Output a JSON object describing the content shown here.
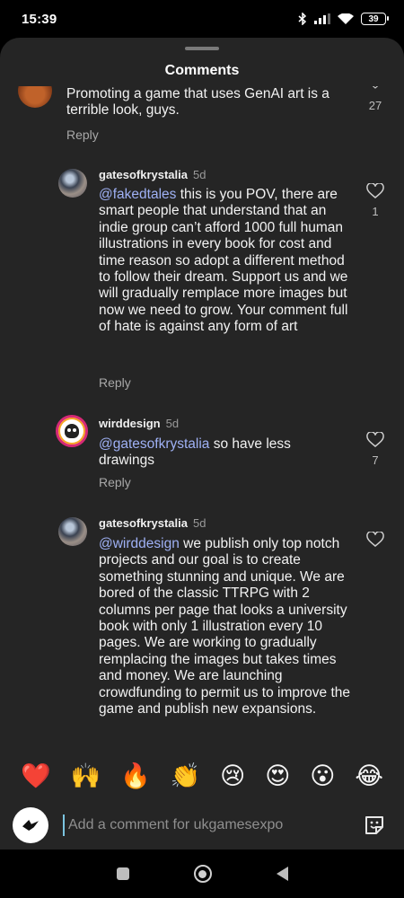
{
  "status": {
    "time": "15:39",
    "battery": "39"
  },
  "sheet": {
    "title": "Comments"
  },
  "comments": [
    {
      "text": "Promoting a game that uses GenAI art is a terrible look, guys.",
      "reply_label": "Reply",
      "likes": "27"
    },
    {
      "username": "gatesofkrystalia",
      "age": "5d",
      "mention": "@fakedtales",
      "text": " this is you POV, there are smart people that understand that an indie group can’t afford 1000 full human illustrations in every book for cost and time reason so adopt a different method to follow their dream. Support us and we will gradually remplace more images but now we need to grow. Your comment full of hate is against any form of art",
      "reply_label": "Reply",
      "likes": "1"
    },
    {
      "username": "wirddesign",
      "age": "5d",
      "mention": "@gatesofkrystalia",
      "text": " so have less drawings",
      "reply_label": "Reply",
      "likes": "7"
    },
    {
      "username": "gatesofkrystalia",
      "age": "5d",
      "mention": "@wirddesign",
      "text": " we publish only top notch projects and our goal is to create something stunning and unique. We are bored of the classic TTRPG with 2 columns per page that looks a university book with only 1 illustration every 10 pages. We are working to gradually remplacing the images but takes times and money. We are launching crowdfunding to permit us to improve the game and publish new expansions."
    }
  ],
  "emoji_bar": [
    "❤️",
    "🙌",
    "🔥",
    "👏",
    "😢",
    "😍",
    "😮",
    "😂"
  ],
  "composer": {
    "placeholder": "Add a comment for ukgamesexpo"
  }
}
